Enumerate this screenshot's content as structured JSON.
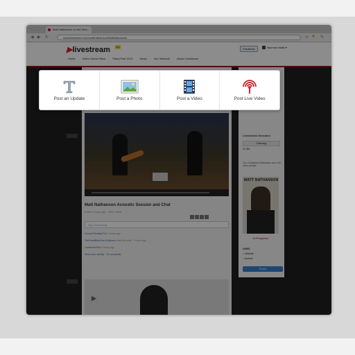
{
  "browser": {
    "tab_title": "Matt Nathanson on the New...",
    "url": "www.livestream.com/mattnathanson/MattNathanson"
  },
  "site": {
    "logo": "livestream",
    "beta_badge": "beta",
    "nav": [
      "Home",
      "Video Ocean Race",
      "Paley Fest 2013",
      "Music",
      "NLL Network",
      "About Livestream"
    ],
    "feedback": "Feedback",
    "user": "Nauman Malik"
  },
  "post": {
    "title": "Matt Nathanson Acoustic Session and Chat",
    "meta": "Posted 3 hours ago · 1000+ Views",
    "comment_placeholder": "Say Something...",
    "activity": [
      {
        "name": "Vincent Pendley Fox",
        "time": "2 hours ago"
      },
      {
        "name": "TheGreatBlueVisa Guillaume",
        "time": "liked this post · 2 hours ago"
      },
      {
        "name": "LivestreamFan",
        "time": "6 hours ago"
      }
    ],
    "view_all": "View more activity · 10 comments"
  },
  "sidebar": {
    "channel": "Livestream Sessions",
    "follow_btn": "Following",
    "stats": "11,280",
    "text": "You & Matthew Nathanson and 100 other people.",
    "poster_name": "MATT NATHANSON",
    "status": "In Progress",
    "links_title": "LINKS",
    "links": [
      "Website",
      "Archive"
    ],
    "share": "Share"
  },
  "modal": {
    "options": [
      {
        "label": "Post an Update",
        "icon": "text-icon"
      },
      {
        "label": "Post a Photo",
        "icon": "photo-icon"
      },
      {
        "label": "Post a Video",
        "icon": "film-icon"
      },
      {
        "label": "Post Live Video",
        "icon": "broadcast-icon"
      }
    ]
  },
  "colors": {
    "brand_red": "#d1232a",
    "overlay": "rgba(0,0,0,0.45)",
    "share_blue": "#3b7fd1"
  }
}
